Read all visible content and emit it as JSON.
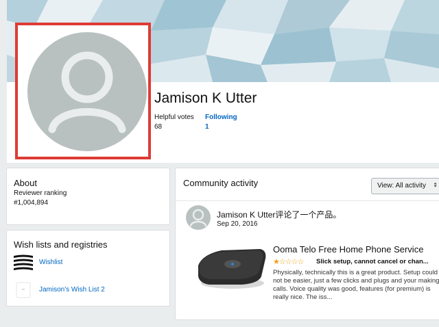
{
  "profile": {
    "name": "Jamison K Utter",
    "helpful_votes_label": "Helpful votes",
    "helpful_votes_value": "68",
    "following_label": "Following",
    "following_value": "1"
  },
  "about": {
    "title": "About",
    "ranking_label": "Reviewer ranking",
    "ranking_value": "#1,004,894"
  },
  "wishlists": {
    "title": "Wish lists and registries",
    "items": [
      {
        "label": "Wishlist",
        "icon": "wishlist-stripes-icon"
      },
      {
        "label": "Jamison's Wish List 2",
        "icon": "wishlist-blank-icon"
      }
    ]
  },
  "activity": {
    "title": "Community activity",
    "view_select": "View: All activity",
    "chevron": "⇕",
    "post": {
      "author_action": "Jamison K Utter评论了一个产品。",
      "date": "Sep 20, 2016",
      "product_title": "Ooma Telo Free Home Phone Service",
      "rating": 1,
      "stars_filled": "★",
      "stars_empty": "☆☆☆☆",
      "review_title": "Slick setup, cannot cancel or chan...",
      "review_body": "Physically, technically this is a great product. Setup could not be easier, just a few clicks and plugs and your making calls. Voice quality was good, features (for premium) is really nice. The iss..."
    }
  },
  "colors": {
    "highlight_border": "#dd3b34",
    "link": "#0066c0",
    "avatar_bg": "#b9c0c0",
    "star": "#f0a010"
  }
}
